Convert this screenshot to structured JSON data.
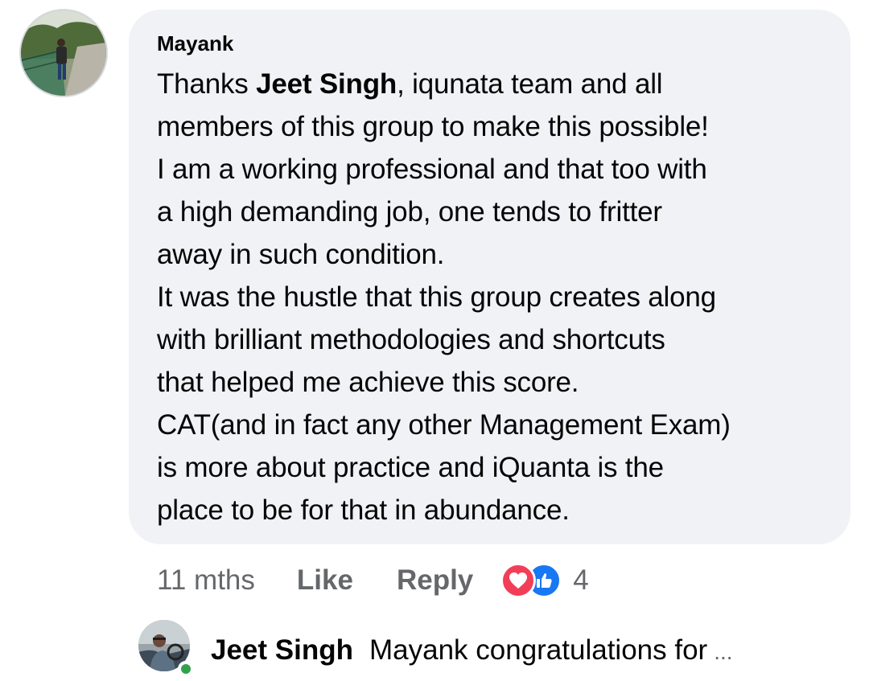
{
  "comment": {
    "author": "Mayank",
    "body_lines": [
      {
        "before": "Thanks ",
        "mention": "Jeet Singh",
        "after": ", iqunata team and all"
      },
      {
        "text": "members of this group to make this possible!"
      },
      {
        "text": "I am a working professional and that too with"
      },
      {
        "text": "a high demanding job, one tends to fritter"
      },
      {
        "text": "away in such condition."
      },
      {
        "text": "It was the hustle that this group creates along"
      },
      {
        "text": "with brilliant methodologies and shortcuts"
      },
      {
        "text": "that helped me achieve this score."
      },
      {
        "text": "CAT(and in fact any other Management Exam)"
      },
      {
        "text": "is more about practice and iQuanta is the"
      },
      {
        "text": "place to be for that in abundance."
      }
    ],
    "timestamp": "11 mths",
    "like_label": "Like",
    "reply_label": "Reply",
    "reaction_icons": [
      "heart-icon",
      "thumbs-up-icon"
    ],
    "reaction_count": "4"
  },
  "reply_preview": {
    "author": "Jeet Singh",
    "text": "Mayank congratulations for",
    "ellipsis": "..."
  },
  "colors": {
    "bubble_bg": "#f0f2f5",
    "secondary_text": "#65676b",
    "love": "#f33e58",
    "like": "#1877f2",
    "online": "#31a24c"
  }
}
